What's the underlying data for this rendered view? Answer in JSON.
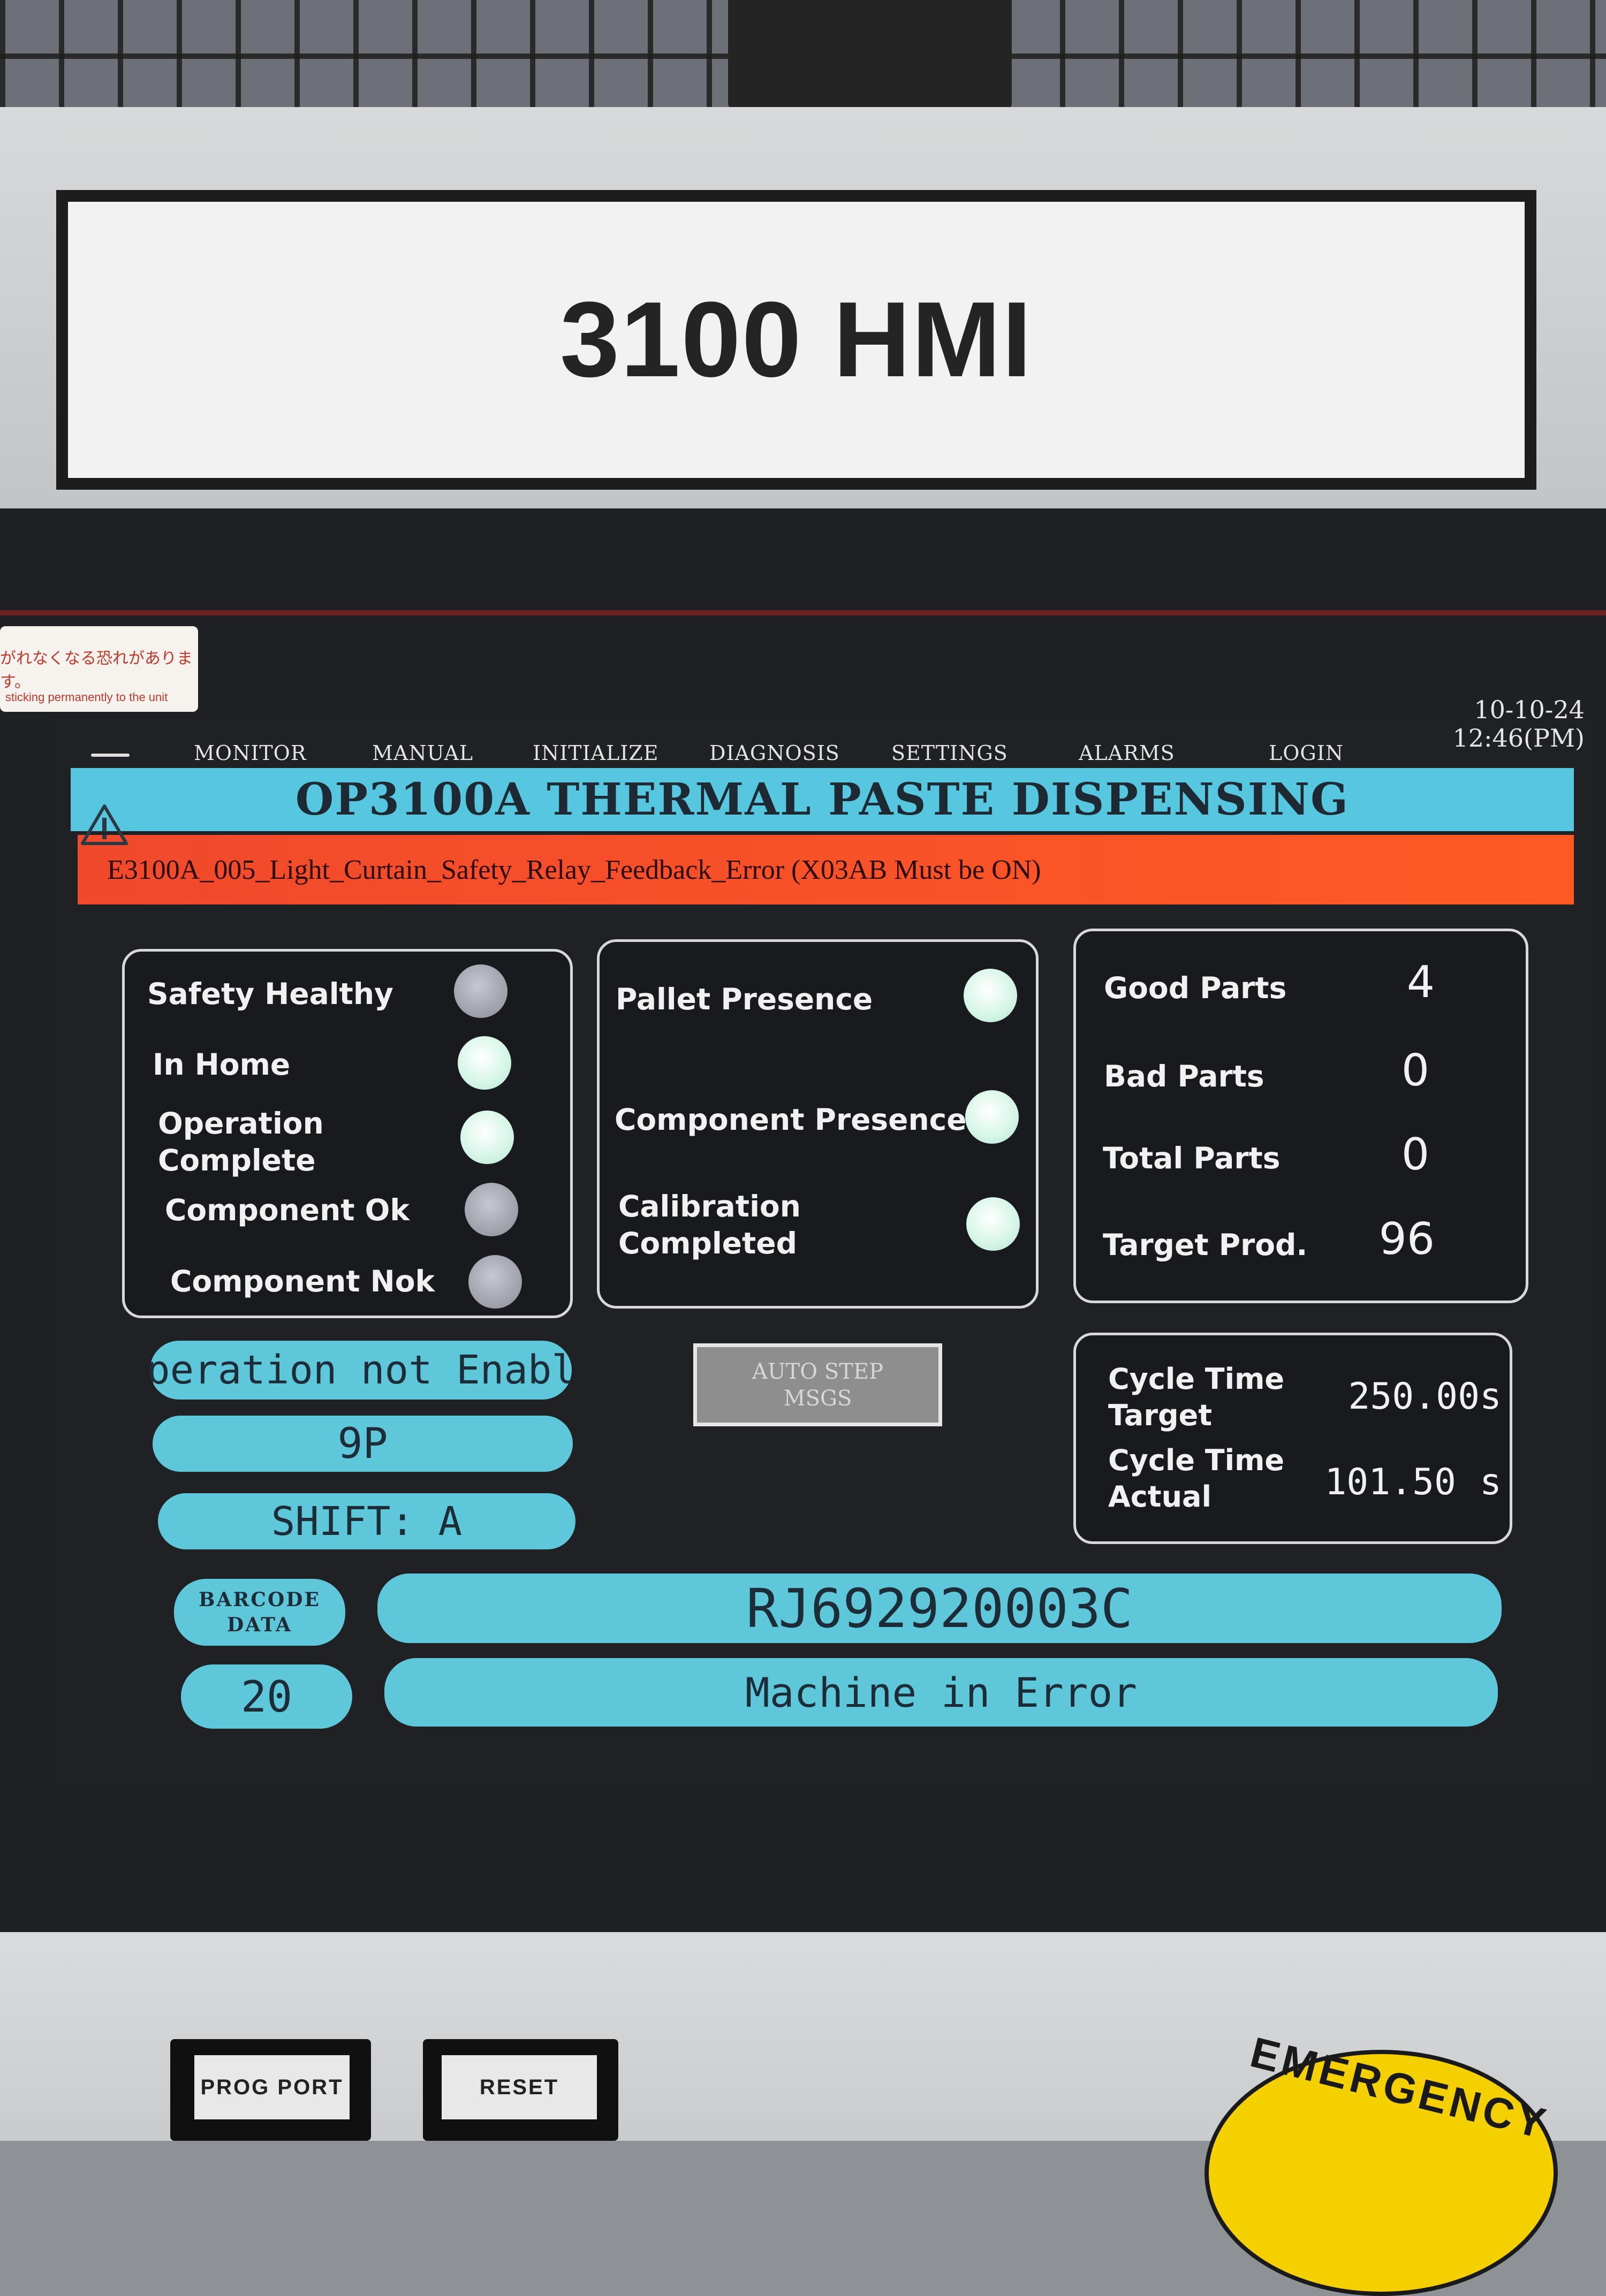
{
  "nameplate": {
    "title": "3100 HMI"
  },
  "sticker": {
    "jp_text": "がれなくなる恐れがあります。",
    "en_text": "sticking permanently to the unit"
  },
  "datetime": {
    "date": "10-10-24",
    "time": "12:46(PM)"
  },
  "nav": {
    "items": [
      {
        "label": "MONITOR"
      },
      {
        "label": "MANUAL"
      },
      {
        "label": "INITIALIZE"
      },
      {
        "label": "DIAGNOSIS"
      },
      {
        "label": "SETTINGS"
      },
      {
        "label": "ALARMS"
      },
      {
        "label": "LOGIN"
      }
    ]
  },
  "header": {
    "title": "OP3100A THERMAL PASTE DISPENSING"
  },
  "alarm": {
    "text": "E3100A_005_Light_Curtain_Safety_Relay_Feedback_Error (X03AB Must be ON)"
  },
  "status_panel": {
    "items": [
      {
        "label": "Safety Healthy",
        "state": "off"
      },
      {
        "label": "In Home",
        "state": "on"
      },
      {
        "label": "Operation Complete",
        "state": "on"
      },
      {
        "label": "Component Ok",
        "state": "off"
      },
      {
        "label": "Component Nok",
        "state": "off"
      }
    ]
  },
  "presence_panel": {
    "items": [
      {
        "label": "Pallet Presence",
        "state": "on"
      },
      {
        "label": "Component Presence",
        "state": "on"
      },
      {
        "label": "Calibration Completed",
        "state": "on"
      }
    ]
  },
  "counts_panel": {
    "items": [
      {
        "label": "Good Parts",
        "value": "4"
      },
      {
        "label": "Bad Parts",
        "value": "0"
      },
      {
        "label": "Total Parts",
        "value": "0"
      },
      {
        "label": "Target Prod.",
        "value": "96"
      }
    ]
  },
  "cycle_panel": {
    "target_label": "Cycle Time Target",
    "target_value": "250.00s",
    "actual_label": "Cycle Time Actual",
    "actual_value": "101.50",
    "actual_unit": "s"
  },
  "left_pills": {
    "operation_status": "Operation not Enable",
    "model": "9P",
    "shift": "SHIFT: A"
  },
  "auto_step": {
    "line1": "AUTO STEP",
    "line2": "MSGS"
  },
  "barcode": {
    "label_line1": "BARCODE",
    "label_line2": "DATA",
    "value": "RJ692920003C"
  },
  "status_row": {
    "code": "20",
    "message": "Machine in Error"
  },
  "hardware": {
    "prog_port": "PROG PORT",
    "reset": "RESET",
    "emergency": "EMERGENCY"
  },
  "colors": {
    "accent_cyan": "#56c7df",
    "alarm_red": "#f0492c",
    "lamp_on": "#d4f5e6",
    "lamp_off": "#9c9ea8"
  }
}
